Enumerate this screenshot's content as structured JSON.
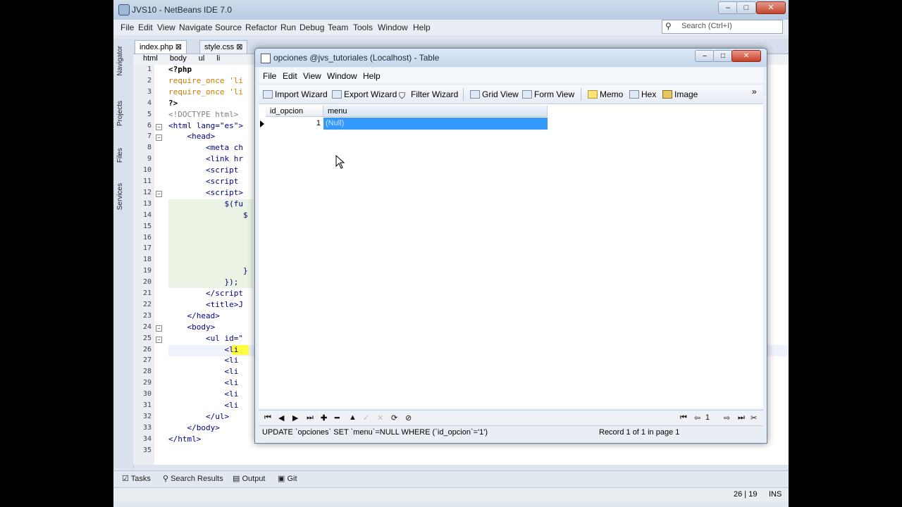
{
  "ide": {
    "title": "JVS10 - NetBeans IDE 7.0",
    "menu": [
      "File",
      "Edit",
      "View",
      "Navigate",
      "Source",
      "Refactor",
      "Run",
      "Debug",
      "Team",
      "Tools",
      "Window",
      "Help"
    ],
    "search_placeholder": "Search (Ctrl+I)",
    "side_tabs": [
      "Navigator",
      "Projects",
      "Files",
      "Services"
    ],
    "editor_tabs": [
      "index.php",
      "style.css"
    ],
    "breadcrumbs": [
      "html",
      "body",
      "ul",
      "li"
    ],
    "line_numbers": [
      "1",
      "2",
      "3",
      "4",
      "5",
      "6",
      "7",
      "8",
      "9",
      "10",
      "11",
      "12",
      "13",
      "14",
      "15",
      "16",
      "17",
      "18",
      "19",
      "20",
      "21",
      "22",
      "23",
      "24",
      "25",
      "26",
      "27",
      "28",
      "29",
      "30",
      "31",
      "32",
      "33",
      "34",
      "35"
    ],
    "code_lines": [
      "<?php",
      "require_once 'li",
      "require_once 'li",
      "?>",
      "<!DOCTYPE html>",
      "<html lang=\"es\">",
      "    <head>",
      "        <meta ch",
      "        <link hr",
      "        <script ",
      "        <script ",
      "        <script>",
      "            $(fu",
      "                $",
      "",
      "",
      "",
      "",
      "                }",
      "            });",
      "        </script",
      "        <title>J",
      "    </head>",
      "    <body>",
      "        <ul id=\"",
      "            <li",
      "            <li",
      "            <li",
      "            <li",
      "            <li",
      "            <li",
      "        </ul>",
      "    </body>",
      "</html>",
      ""
    ],
    "bottom_tabs": [
      "Tasks",
      "Search Results",
      "Output",
      "Git"
    ],
    "status_position": "26 | 19",
    "status_mode": "INS"
  },
  "table_window": {
    "title": "opciones @jvs_tutoriales (Localhost) - Table",
    "menu": [
      "File",
      "Edit",
      "View",
      "Window",
      "Help"
    ],
    "toolbar": [
      "Import Wizard",
      "Export Wizard",
      "Filter Wizard",
      "Grid View",
      "Form View",
      "Memo",
      "Hex",
      "Image"
    ],
    "toolbar_overflow": "»",
    "columns": [
      "id_opcion",
      "menu"
    ],
    "rows": [
      {
        "id_opcion": "1",
        "menu": "(Null)"
      }
    ],
    "page_number": "1",
    "status_sql": "UPDATE `opciones` SET `menu`=NULL WHERE (`id_opcion`='1')",
    "status_record": "Record 1 of 1 in page 1"
  }
}
